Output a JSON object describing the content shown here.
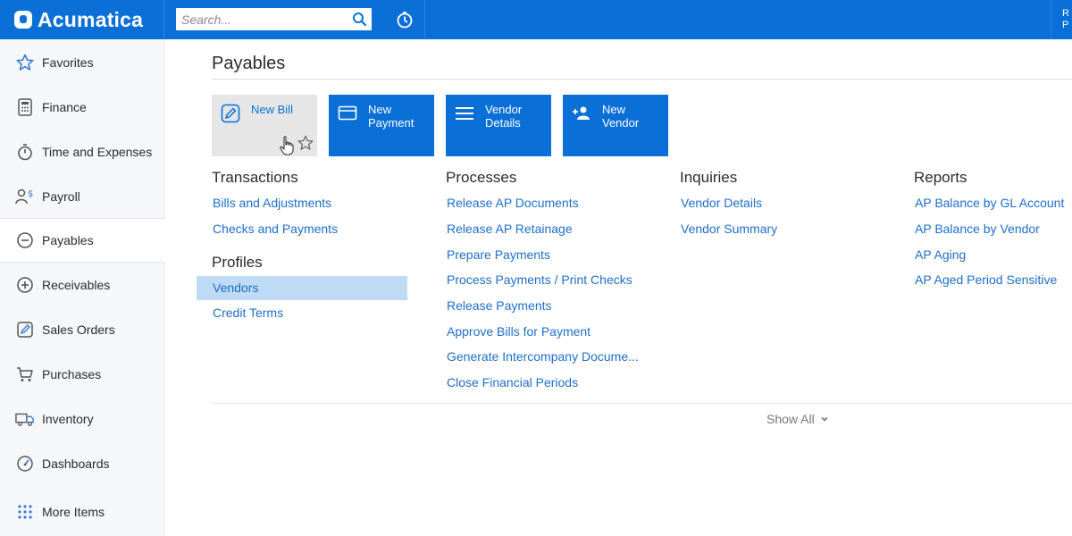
{
  "app": {
    "name": "Acumatica",
    "user_initials": [
      "R",
      "P"
    ]
  },
  "search": {
    "placeholder": "Search..."
  },
  "sidebar": {
    "items": [
      {
        "label": "Favorites",
        "icon": "star-icon"
      },
      {
        "label": "Finance",
        "icon": "calculator-icon"
      },
      {
        "label": "Time and Expenses",
        "icon": "stopwatch-icon"
      },
      {
        "label": "Payroll",
        "icon": "person-dollar-icon"
      },
      {
        "label": "Payables",
        "icon": "minus-circle-icon",
        "active": true
      },
      {
        "label": "Receivables",
        "icon": "plus-circle-icon"
      },
      {
        "label": "Sales Orders",
        "icon": "edit-icon"
      },
      {
        "label": "Purchases",
        "icon": "cart-icon"
      },
      {
        "label": "Inventory",
        "icon": "truck-icon"
      },
      {
        "label": "Dashboards",
        "icon": "gauge-icon"
      },
      {
        "label": "More Items",
        "icon": "grid-dots-icon"
      }
    ]
  },
  "page": {
    "title": "Payables"
  },
  "tiles": [
    {
      "label": "New Bill",
      "icon": "pencil-icon",
      "hovered": true
    },
    {
      "label": "New Payment",
      "icon": "card-icon"
    },
    {
      "label": "Vendor Details",
      "icon": "list-icon"
    },
    {
      "label": "New Vendor",
      "icon": "add-person-icon"
    }
  ],
  "sections": {
    "transactions": {
      "title": "Transactions",
      "links": [
        "Bills and Adjustments",
        "Checks and Payments"
      ]
    },
    "profiles": {
      "title": "Profiles",
      "links": [
        "Vendors",
        "Credit Terms"
      ],
      "selected": "Vendors"
    },
    "processes": {
      "title": "Processes",
      "links": [
        "Release AP Documents",
        "Release AP Retainage",
        "Prepare Payments",
        "Process Payments / Print Checks",
        "Release Payments",
        "Approve Bills for Payment",
        "Generate Intercompany Docume...",
        "Close Financial Periods"
      ]
    },
    "inquiries": {
      "title": "Inquiries",
      "links": [
        "Vendor Details",
        "Vendor Summary"
      ]
    },
    "reports": {
      "title": "Reports",
      "links": [
        "AP Balance by GL Account",
        "AP Balance by Vendor",
        "AP Aging",
        "AP Aged Period Sensitive"
      ]
    }
  },
  "show_all": {
    "label": "Show All"
  },
  "colors": {
    "brand": "#0a6fd6",
    "link": "#1e6ec8",
    "selected": "#bfdaf5"
  }
}
